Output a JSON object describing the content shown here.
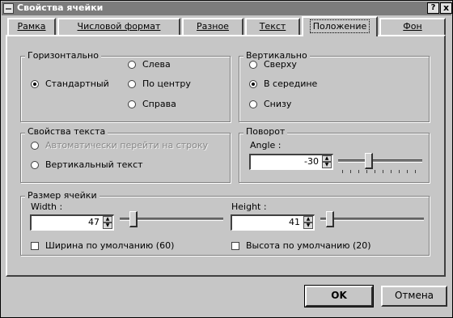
{
  "window": {
    "title": "Свойства ячейки",
    "help_label": "?",
    "close_label": "x"
  },
  "tabs": [
    {
      "label": "Рамка"
    },
    {
      "label": "Числовой формат"
    },
    {
      "label": "Разное"
    },
    {
      "label": "Текст"
    },
    {
      "label": "Положение",
      "active": true
    },
    {
      "label": "Фон"
    }
  ],
  "horizontal": {
    "title": "Горизонтально",
    "options": [
      "Стандартный",
      "Слева",
      "По центру",
      "Справа"
    ],
    "selected": "Стандартный"
  },
  "vertical": {
    "title": "Вертикально",
    "options": [
      "Сверху",
      "В середине",
      "Снизу"
    ],
    "selected": "В середине"
  },
  "text_props": {
    "title": "Свойства текста",
    "auto_wrap": "Автоматически перейти на строку",
    "vertical_text": "Вертикальный текст"
  },
  "rotation": {
    "title": "Поворот",
    "angle_label": "Angle :",
    "angle_value": "-30"
  },
  "cell_size": {
    "title": "Размер ячейки",
    "width_label": "Width :",
    "width_value": "47",
    "height_label": "Height :",
    "height_value": "41",
    "default_width": "Ширина по умолчанию (60)",
    "default_height": "Высота по умолчанию (20)"
  },
  "buttons": {
    "ok": "OK",
    "cancel": "Отмена"
  },
  "icons": {
    "spin_up": "up-arrow-icon",
    "spin_down": "down-arrow-icon"
  }
}
